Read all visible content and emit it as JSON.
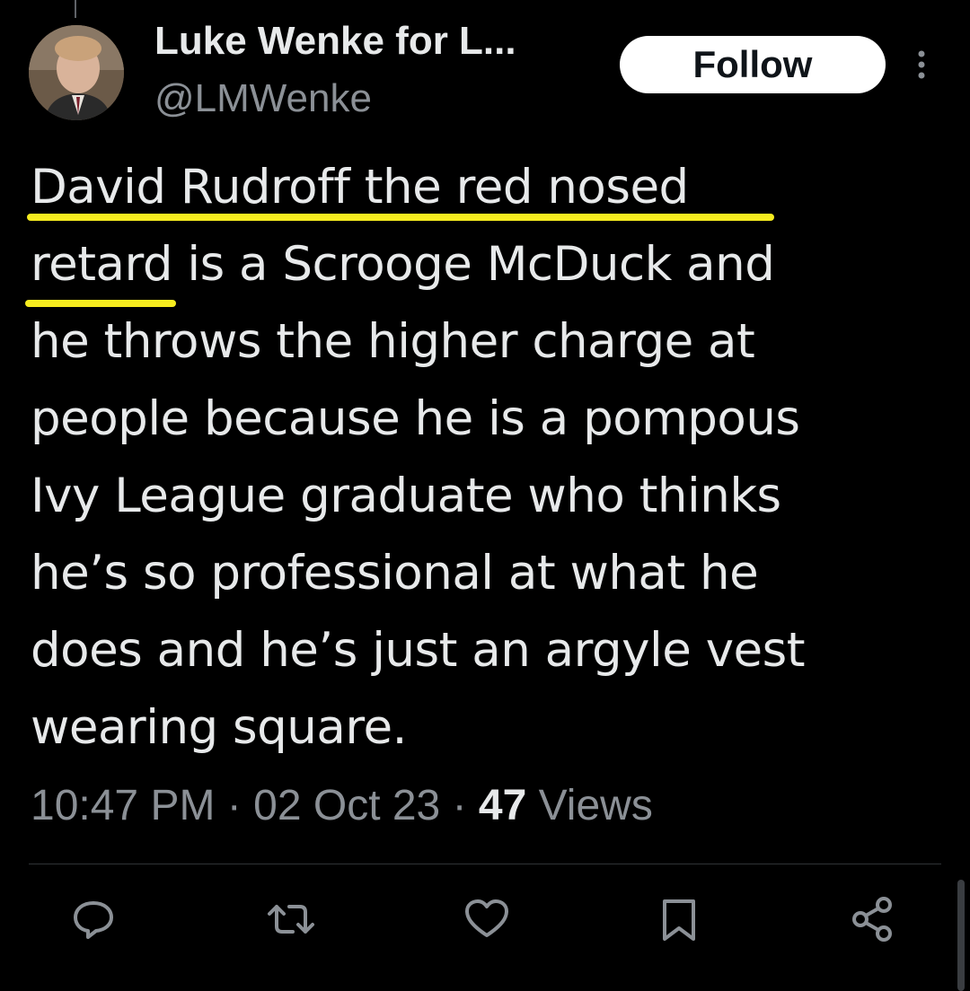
{
  "author": {
    "display_name": "Luke Wenke for L...",
    "handle": "@LMWenke"
  },
  "follow_button": {
    "label": "Follow"
  },
  "tweet": {
    "lines": [
      "David Rudroff the red nosed",
      "retard is a Scrooge McDuck and",
      "he throws the higher charge at",
      "people because he is a pompous",
      "Ivy League graduate who thinks",
      "he’s so professional at what he",
      "does and he’s just an argyle vest",
      "wearing square."
    ],
    "highlight_color": "#f6ec1f"
  },
  "meta": {
    "time": "10:47 PM",
    "separator": "·",
    "date": "02 Oct 23",
    "views_count": "47",
    "views_label": "Views"
  },
  "actions": [
    {
      "name": "reply",
      "icon": "speech-bubble-icon"
    },
    {
      "name": "retweet",
      "icon": "retweet-arrows-icon"
    },
    {
      "name": "like",
      "icon": "heart-icon"
    },
    {
      "name": "bookmark",
      "icon": "bookmark-icon"
    },
    {
      "name": "share",
      "icon": "share-nodes-icon"
    }
  ],
  "colors": {
    "background": "#000000",
    "text_primary": "#e7e9ea",
    "text_secondary": "#8b9096",
    "divider": "#2f3336",
    "button_bg": "#ffffff"
  }
}
